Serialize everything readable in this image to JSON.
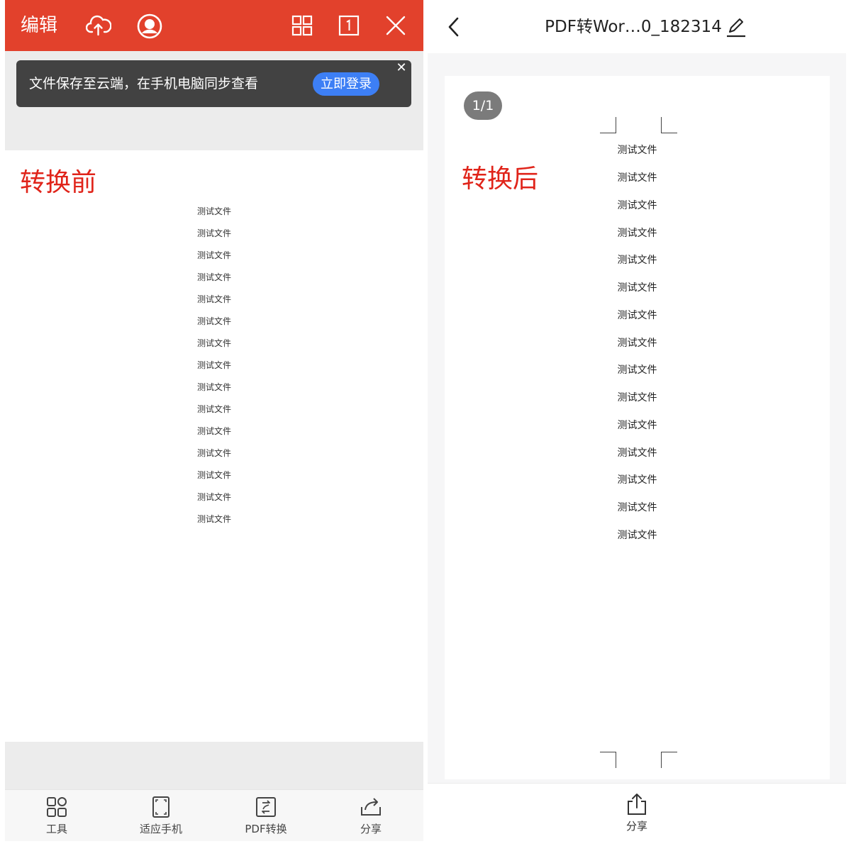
{
  "left_panel": {
    "topbar": {
      "edit_label": "编辑",
      "icons": [
        "cloud-upload-icon",
        "account-icon",
        "grid-view-icon",
        "single-page-icon",
        "close-icon"
      ],
      "background_color": "#e2412c"
    },
    "toast": {
      "message": "文件保存至云端，在手机电脑同步查看",
      "action_label": "立即登录",
      "close_symbol": "✕"
    },
    "annotation": "转换前",
    "document_lines": [
      "测试文件",
      "测试文件",
      "测试文件",
      "测试文件",
      "测试文件",
      "测试文件",
      "测试文件",
      "测试文件",
      "测试文件",
      "测试文件",
      "测试文件",
      "测试文件",
      "测试文件",
      "测试文件",
      "测试文件"
    ],
    "toolbar": [
      {
        "label": "工具",
        "icon": "tools-grid-icon"
      },
      {
        "label": "适应手机",
        "icon": "fit-phone-icon"
      },
      {
        "label": "PDF转换",
        "icon": "pdf-convert-icon"
      },
      {
        "label": "分享",
        "icon": "share-arrow-icon"
      }
    ]
  },
  "right_panel": {
    "header": {
      "title": "PDF转Wor…0_182314",
      "icons": [
        "back-chevron-icon",
        "edit-pencil-icon"
      ]
    },
    "page_indicator": "1/1",
    "annotation": "转换后",
    "document_lines": [
      "测试文件",
      "测试文件",
      "测试文件",
      "测试文件",
      "测试文件",
      "测试文件",
      "测试文件",
      "测试文件",
      "测试文件",
      "测试文件",
      "测试文件",
      "测试文件",
      "测试文件",
      "测试文件",
      "测试文件"
    ],
    "footer": {
      "share_label": "分享",
      "icon": "share-upload-icon"
    }
  },
  "colors": {
    "accent_red": "#e2412c",
    "annotation_red": "#e0241a",
    "login_blue": "#3d7ff5",
    "toast_bg": "#424242"
  }
}
